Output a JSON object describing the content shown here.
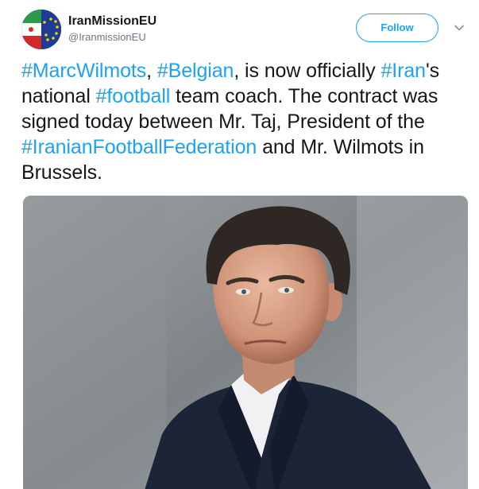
{
  "user": {
    "display_name": "IranMissionEU",
    "screen_name": "@IranmissionEU",
    "avatar_icon": "iran-eu-flag-avatar"
  },
  "header": {
    "follow_label": "Follow",
    "menu_icon": "chevron-down-icon"
  },
  "tweet": {
    "segments": [
      {
        "type": "hashtag",
        "text": "#MarcWilmots"
      },
      {
        "type": "text",
        "text": ", "
      },
      {
        "type": "hashtag",
        "text": "#Belgian"
      },
      {
        "type": "text",
        "text": ", is now officially "
      },
      {
        "type": "hashtag",
        "text": "#Iran"
      },
      {
        "type": "text",
        "text": "'s national "
      },
      {
        "type": "hashtag",
        "text": "#football"
      },
      {
        "type": "text",
        "text": " team coach. The contract was signed today between Mr. Taj, President of the "
      },
      {
        "type": "hashtag",
        "text": "#IranianFootballFederation"
      },
      {
        "type": "text",
        "text": " and Mr. Wilmots in Brussels."
      }
    ]
  },
  "media": {
    "subject": "photo of a man in a dark suit and white shirt"
  },
  "colors": {
    "link": "#1da1f2",
    "text": "#14171a",
    "secondary": "#657786"
  }
}
